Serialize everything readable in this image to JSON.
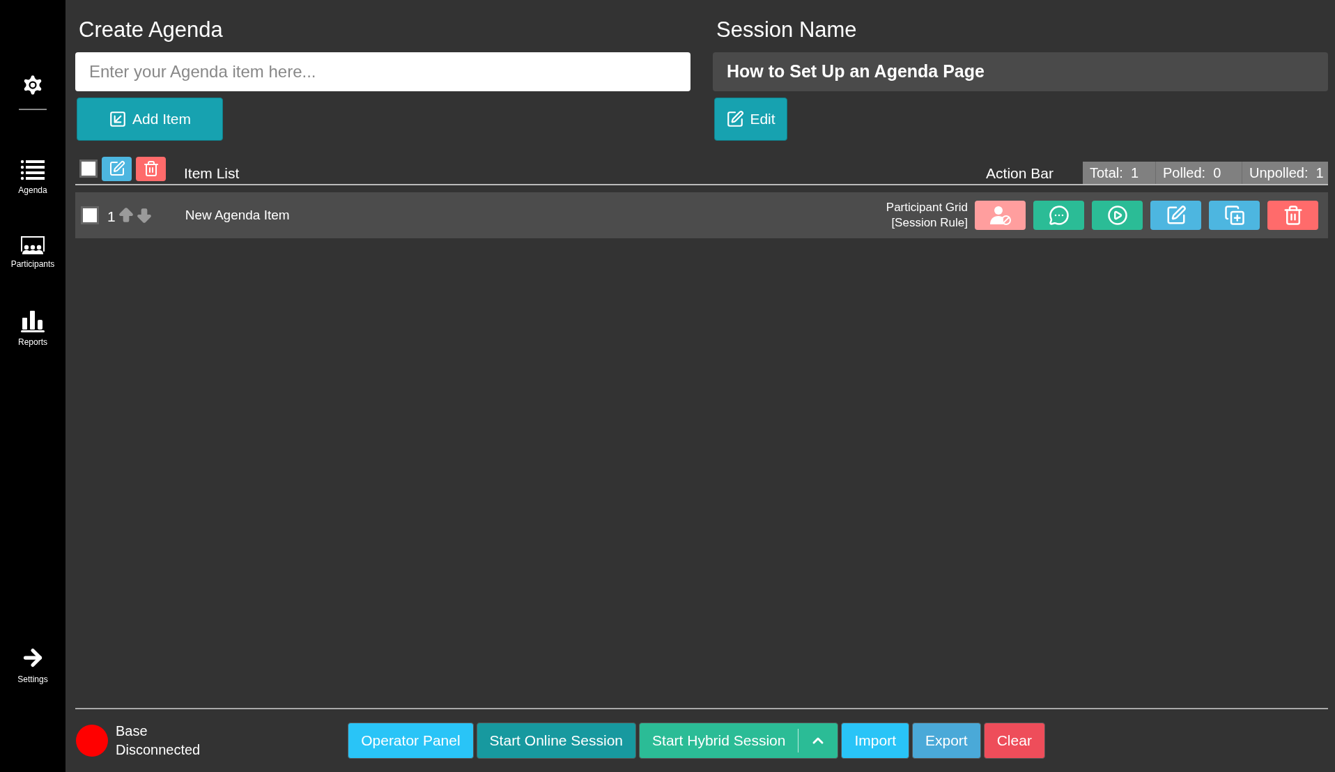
{
  "sidebar": {
    "items": [
      {
        "kind": "settings"
      },
      {
        "kind": "agenda",
        "label": "Agenda"
      },
      {
        "kind": "participants",
        "label": "Participants"
      },
      {
        "kind": "reports",
        "label": "Reports"
      }
    ],
    "bottom_item": {
      "label": "Settings"
    }
  },
  "create_agenda": {
    "title": "Create Agenda",
    "placeholder": "Enter your Agenda item here...",
    "button": "Add Item"
  },
  "session": {
    "title": "Session Name",
    "value": "How to Set Up an Agenda Page",
    "button": "Edit"
  },
  "item_list": {
    "select_all": {
      "checked": false
    },
    "heading": "Item List",
    "action_heading": "Action Bar",
    "stats": [
      "Total:  1",
      "Polled:  0",
      "Unpolled:  1"
    ],
    "rows": [
      {
        "checked": false,
        "number": "1",
        "title": "New Agenda Item",
        "grid_label": "Participant Grid",
        "rule_label": "[Session Rule]",
        "actions": [
          {
            "kind": "participant-rule"
          },
          {
            "kind": "comment"
          },
          {
            "kind": "play"
          },
          {
            "kind": "edit"
          },
          {
            "kind": "duplicate"
          },
          {
            "kind": "delete"
          }
        ]
      }
    ]
  },
  "status": {
    "title": "Base",
    "state": "Disconnected",
    "color": "#ff0000"
  },
  "footer_buttons": [
    {
      "label": "Operator Panel",
      "kind": "sky"
    },
    {
      "label": "Start Online Session",
      "kind": "teal"
    },
    {
      "label": "Start Hybrid Session",
      "kind": "green-split"
    },
    {
      "label": "Import",
      "kind": "sky"
    },
    {
      "label": "Export",
      "kind": "steel"
    },
    {
      "label": "Clear",
      "kind": "red"
    }
  ]
}
